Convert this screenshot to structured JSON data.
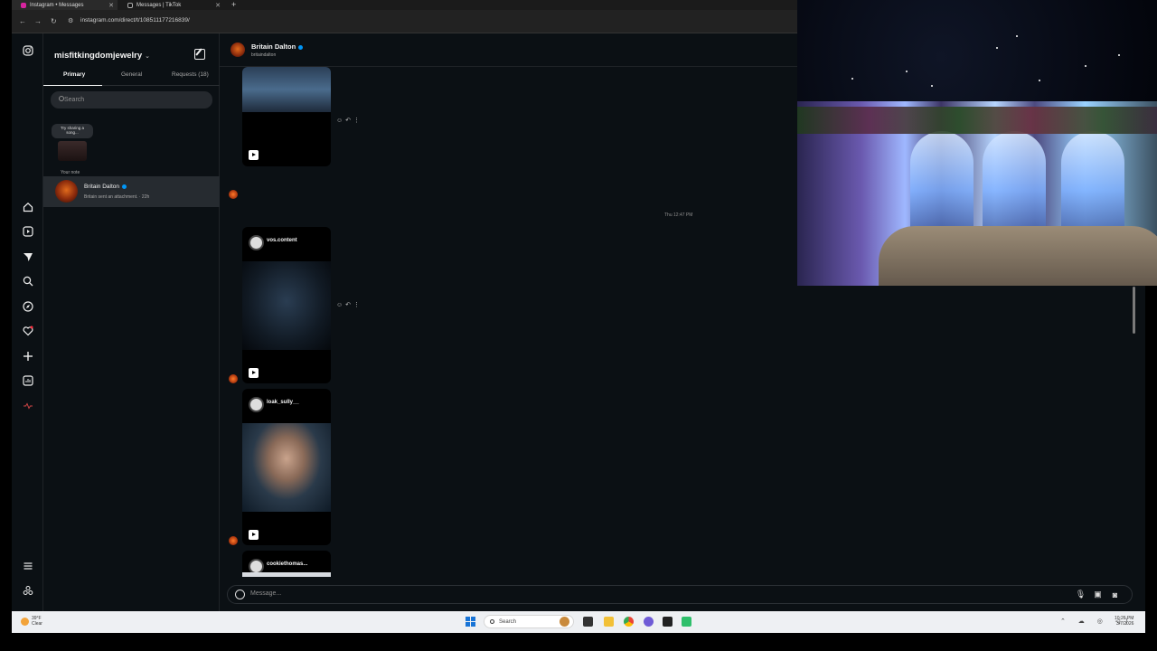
{
  "browser": {
    "tabs": [
      {
        "title": "Instagram • Messages",
        "active": true
      },
      {
        "title": "Messages | TikTok",
        "active": false
      }
    ],
    "new_tab": "+",
    "url": "instagram.com/direct/t/108511177216839/",
    "nav": {
      "back": "←",
      "forward": "→",
      "reload": "C"
    }
  },
  "rail": {
    "icons": [
      "instagram-logo-icon",
      "home-icon",
      "reels-icon",
      "messages-icon",
      "search-icon",
      "explore-icon",
      "notifications-icon",
      "create-icon",
      "dashboard-icon",
      "threads-icon",
      "menu-icon",
      "meta-icon"
    ]
  },
  "inbox": {
    "account": "misfitkingdomjewelry",
    "account_chevron": "⌄",
    "tabs": [
      "Primary",
      "General",
      "Requests (18)"
    ],
    "search_placeholder": "Search",
    "note": {
      "bubble": "Try sharing a song...",
      "label": "Your note"
    },
    "conversations": [
      {
        "name": "Britain Dalton",
        "preview": "Britain sent an attachment. · 22h",
        "verified": true
      }
    ]
  },
  "thread": {
    "name": "Britain Dalton",
    "handle": "britaindalton",
    "timestamp": "Thu 12:47 PM",
    "posts": [
      {
        "author": "",
        "image": "avatar-blue-figures"
      },
      {
        "author": "vos.content",
        "image": "navi-face-dark"
      },
      {
        "author": "loak_sully__",
        "image": "motion-capture-actor"
      },
      {
        "author": "cookiethomas...",
        "image": "two-people"
      }
    ],
    "actions": [
      "☺",
      "↶",
      "⋮"
    ],
    "composer_placeholder": "Message...",
    "composer_icons": [
      "microphone-icon",
      "image-icon",
      "sticker-icon"
    ]
  },
  "taskbar": {
    "weather_temp": "39°F",
    "weather_desc": "Clear",
    "search_placeholder": "Search",
    "time": "10:26 PM",
    "date": "3/7/2026"
  },
  "colors": {
    "app_bg": "#0b1014",
    "selected_conv": "#262b30",
    "verified": "#0095f6"
  }
}
